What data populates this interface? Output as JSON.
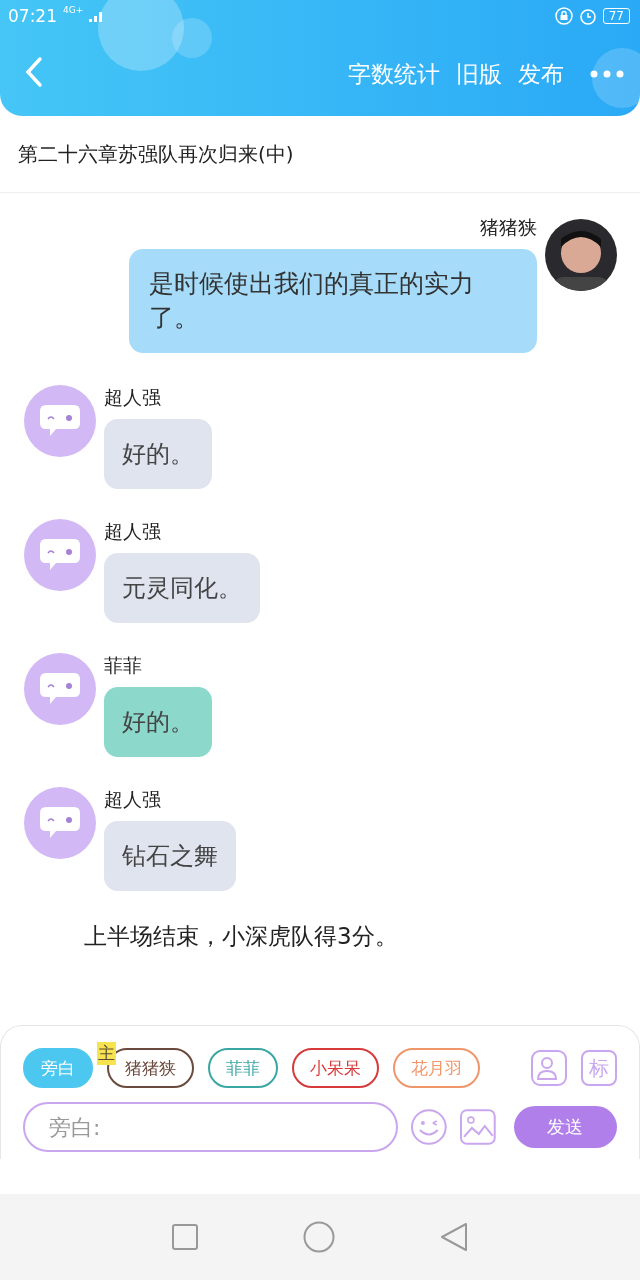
{
  "status_bar": {
    "time": "07:21",
    "network": "4G+",
    "battery": "77"
  },
  "header": {
    "actions": [
      "字数统计",
      "旧版",
      "发布"
    ]
  },
  "chapter_title": "第二十六章苏强队再次归来(中)",
  "messages": [
    {
      "kind": "mine",
      "sender": "猪猪狭",
      "text": "是时候使出我们的真正的实力了。",
      "color": "#a6dcf9"
    },
    {
      "kind": "other",
      "sender": "超人强",
      "text": "好的。",
      "color": "#dfe4ee"
    },
    {
      "kind": "other",
      "sender": "超人强",
      "text": "元灵同化。",
      "color": "#dfe4ee"
    },
    {
      "kind": "other",
      "sender": "菲菲",
      "text": "好的。",
      "color": "#8cd8cb"
    },
    {
      "kind": "other",
      "sender": "超人强",
      "text": "钻石之舞",
      "color": "#dfe4ee"
    },
    {
      "kind": "narration",
      "text": "上半场结束，小深虎队得3分。"
    }
  ],
  "characters": [
    {
      "name": "旁白",
      "color": "#4cc8f0",
      "selected": true
    },
    {
      "name": "猪猪狭",
      "color": "#6b4a3e",
      "selected": false,
      "badge": "主"
    },
    {
      "name": "菲菲",
      "color": "#3aa7a4",
      "selected": false
    },
    {
      "name": "小呆呆",
      "color": "#d83a3a",
      "selected": false
    },
    {
      "name": "花月羽",
      "color": "#f0966a",
      "selected": false
    }
  ],
  "tag_button": "标",
  "input": {
    "placeholder": "旁白:"
  },
  "send_button": "发送"
}
